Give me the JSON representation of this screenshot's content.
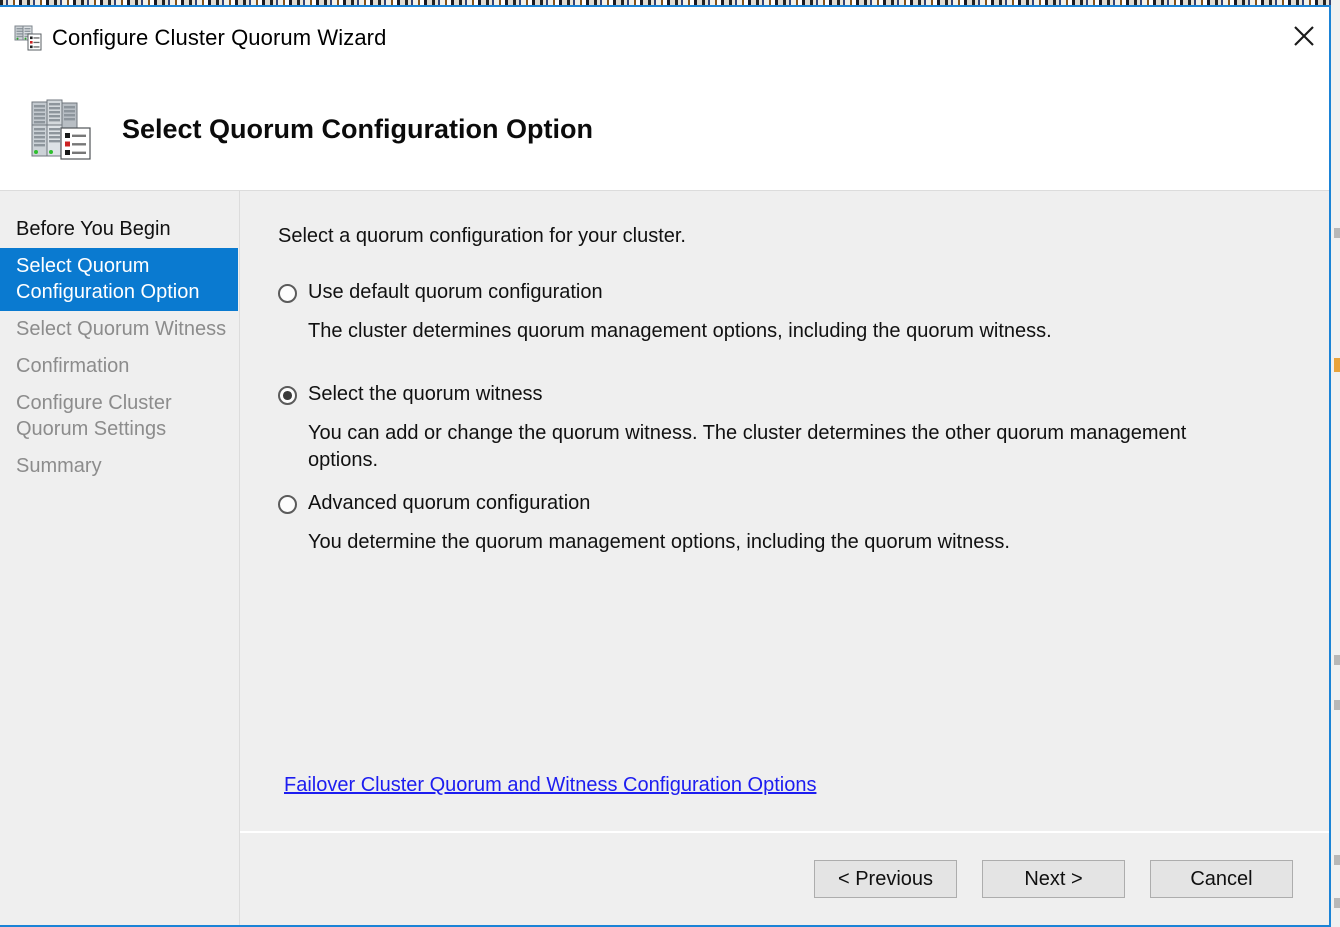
{
  "window": {
    "title": "Configure Cluster Quorum Wizard",
    "title_icon": "cluster-icon",
    "close_icon": "close-icon",
    "accent_color": "#1b83d6",
    "selection_color": "#0a7ad0",
    "link_color": "#1d1df0"
  },
  "banner": {
    "icon": "server-cluster-checklist-icon",
    "title": "Select Quorum Configuration Option"
  },
  "sidebar": {
    "items": [
      {
        "label": "Before You Begin",
        "state": "done"
      },
      {
        "label": "Select Quorum Configuration Option",
        "state": "current"
      },
      {
        "label": "Select Quorum Witness",
        "state": "pending"
      },
      {
        "label": "Confirmation",
        "state": "pending"
      },
      {
        "label": "Configure Cluster Quorum Settings",
        "state": "pending"
      },
      {
        "label": "Summary",
        "state": "pending"
      }
    ]
  },
  "main": {
    "intro": "Select a quorum configuration for your cluster.",
    "options": [
      {
        "label": "Use default quorum configuration",
        "description": "The cluster determines quorum management options, including the quorum witness.",
        "selected": false
      },
      {
        "label": "Select the quorum witness",
        "description": "You can add or change the quorum witness. The cluster determines the other quorum management options.",
        "selected": true
      },
      {
        "label": "Advanced quorum configuration",
        "description": "You determine the quorum management options, including the quorum witness.",
        "selected": false
      }
    ],
    "help_link": "Failover Cluster Quorum and Witness Configuration Options"
  },
  "footer": {
    "previous_label": "< Previous",
    "next_label": "Next >",
    "cancel_label": "Cancel"
  }
}
